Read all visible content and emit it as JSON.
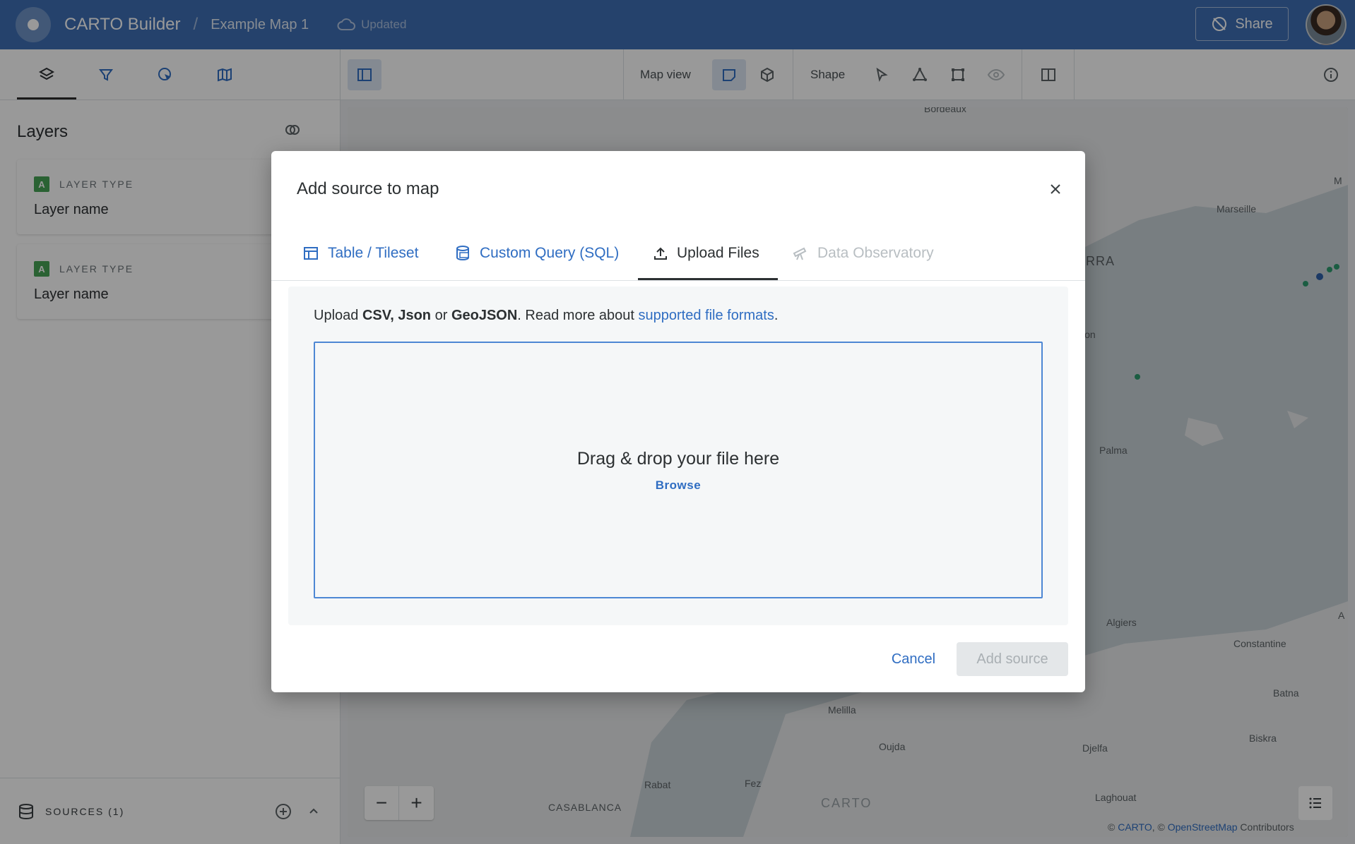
{
  "app": {
    "title": "CARTO Builder",
    "separator": "/",
    "map_title": "Example Map 1",
    "status": "Updated",
    "share_label": "Share"
  },
  "sidebar": {
    "tabs": [
      "layers-icon",
      "filter-icon",
      "interactions-icon",
      "basemap-icon"
    ],
    "layers_title": "Layers",
    "layers": [
      {
        "badge": "A",
        "type": "LAYER TYPE",
        "name": "Layer name"
      },
      {
        "badge": "A",
        "type": "LAYER TYPE",
        "name": "Layer name"
      }
    ],
    "sources_label": "SOURCES (1)"
  },
  "toolbar": {
    "map_view_label": "Map view",
    "shape_label": "Shape"
  },
  "map": {
    "labels": [
      "Bordeaux",
      "Marseille",
      "ORRA",
      "Palma",
      "Algiers",
      "Constantine",
      "Batna",
      "Biskra",
      "Melilla",
      "Oujda",
      "Djelfa",
      "Fez",
      "Rabat",
      "CASABLANCA",
      "Laghouat",
      "M",
      "A",
      "lon"
    ],
    "zoom_out": "−",
    "zoom_in": "+",
    "attribution_prefix": "© ",
    "attribution_carto": "CARTO",
    "attribution_mid": ", © ",
    "attribution_osm": "OpenStreetMap",
    "attribution_suffix": " Contributors",
    "watermark": "CARTO"
  },
  "modal": {
    "title": "Add source to map",
    "tabs": [
      {
        "label": "Table / Tileset",
        "state": "link"
      },
      {
        "label": "Custom Query (SQL)",
        "state": "link"
      },
      {
        "label": "Upload Files",
        "state": "active"
      },
      {
        "label": "Data Observatory",
        "state": "disabled"
      }
    ],
    "upload": {
      "prefix": "Upload ",
      "formats_1": "CSV, Json",
      "or": " or ",
      "formats_2": "GeoJSON",
      "read_more": ". Read more about ",
      "link": "supported file formats",
      "suffix": "."
    },
    "dropzone": {
      "title": "Drag & drop your file here",
      "browse": "Browse"
    },
    "cancel_label": "Cancel",
    "add_label": "Add source"
  },
  "colors": {
    "topbar": "#3f6fb5",
    "link": "#2f6dc2",
    "badge": "#46a355"
  }
}
